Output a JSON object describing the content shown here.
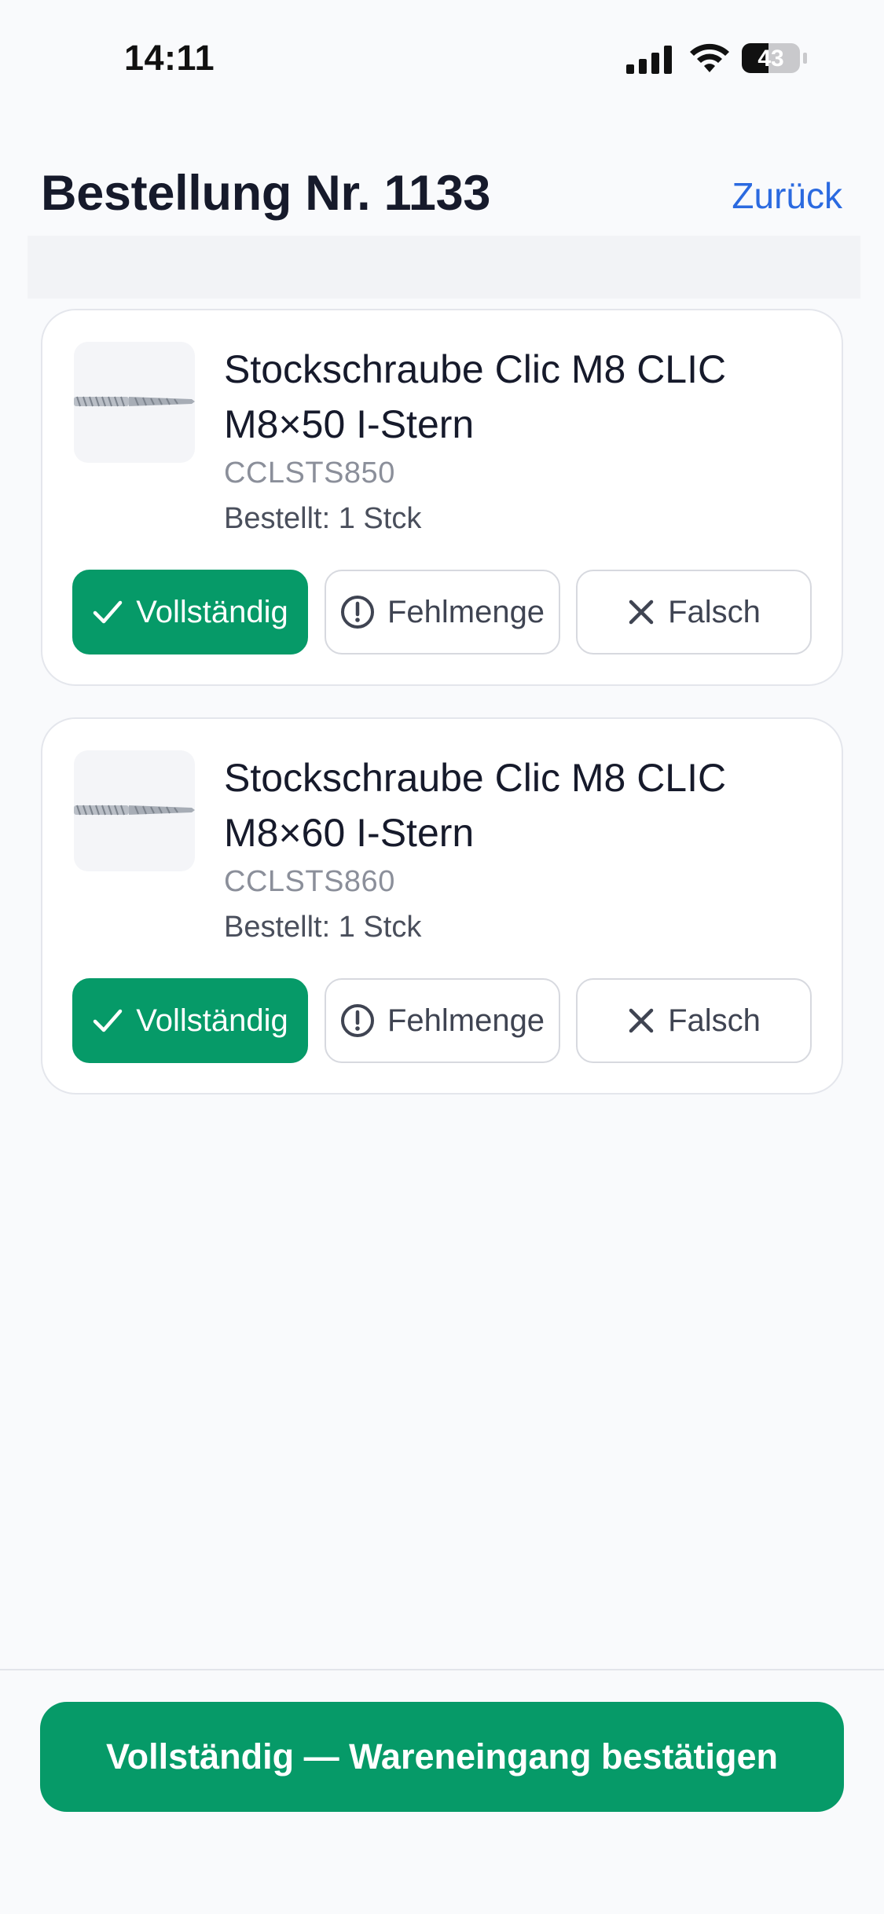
{
  "status_bar": {
    "time": "14:11",
    "battery": "43"
  },
  "header": {
    "title": "Bestellung Nr. 1133",
    "back_label": "Zurück"
  },
  "items": [
    {
      "name_line1": "Stockschraube Clic M8 CLIC",
      "name_line2": "M8×50 I-Stern",
      "sku": "CCLSTS850",
      "ordered": "Bestellt: 1 Stck",
      "actions": {
        "complete": "Vollständig",
        "shortage": "Fehlmenge",
        "wrong": "Falsch"
      },
      "selected": "complete"
    },
    {
      "name_line1": "Stockschraube Clic M8 CLIC",
      "name_line2": "M8×60 I-Stern",
      "sku": "CCLSTS860",
      "ordered": "Bestellt: 1 Stck",
      "actions": {
        "complete": "Vollständig",
        "shortage": "Fehlmenge",
        "wrong": "Falsch"
      },
      "selected": "complete"
    }
  ],
  "footer": {
    "confirm_label": "Vollständig — Wareneingang bestätigen"
  },
  "colors": {
    "accent": "#069a68",
    "link": "#2b6ae0",
    "text": "#161a2b",
    "muted": "#8b8f9a"
  }
}
